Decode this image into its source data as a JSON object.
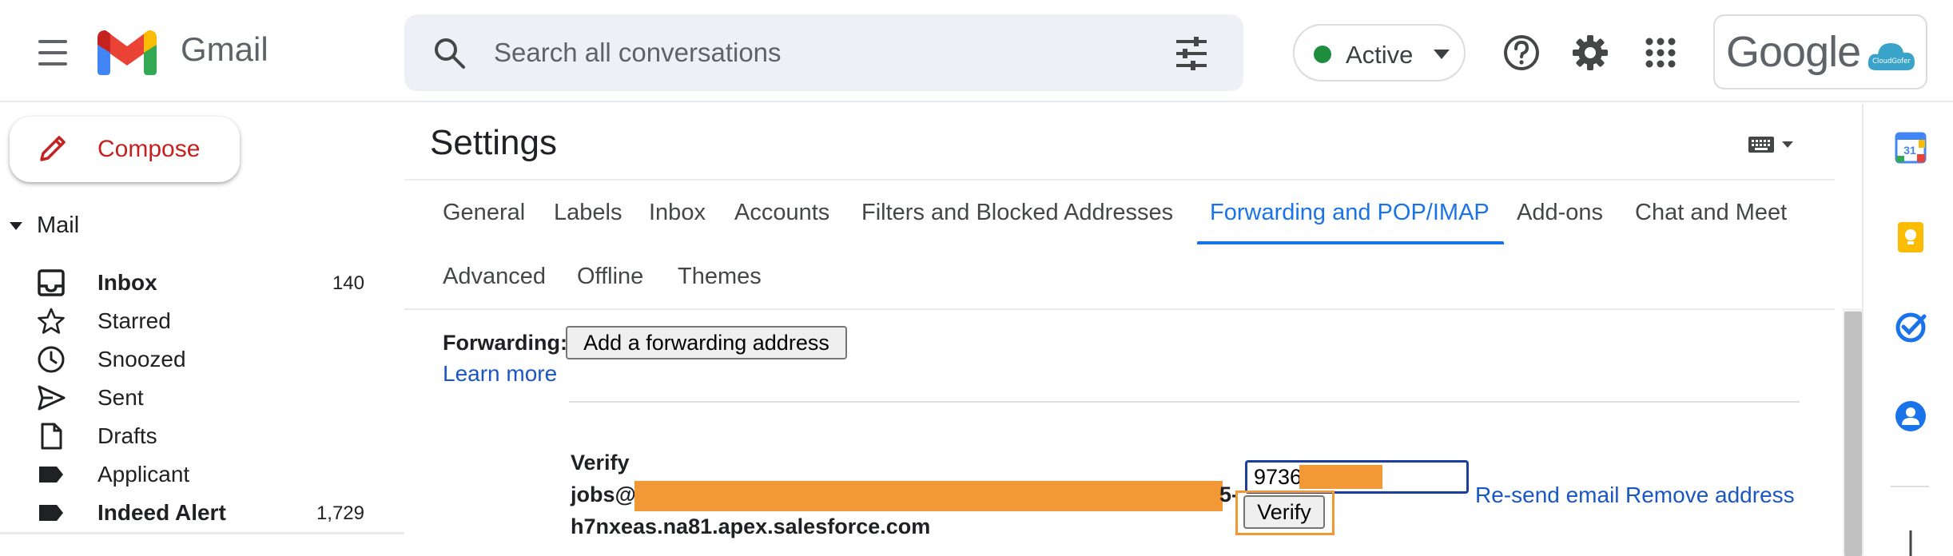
{
  "app": {
    "brand": "Gmail"
  },
  "search": {
    "placeholder": "Search all conversations"
  },
  "status": {
    "label": "Active",
    "color": "#1e8e3e"
  },
  "account": {
    "logo_text": "Google",
    "badge_text": "CloudGofer"
  },
  "compose": {
    "label": "Compose"
  },
  "nav": {
    "section": "Mail",
    "items": [
      {
        "label": "Inbox",
        "count": "140",
        "icon": "inbox-icon",
        "bold": true
      },
      {
        "label": "Starred",
        "count": "",
        "icon": "star-icon"
      },
      {
        "label": "Snoozed",
        "count": "",
        "icon": "clock-icon"
      },
      {
        "label": "Sent",
        "count": "",
        "icon": "send-icon"
      },
      {
        "label": "Drafts",
        "count": "",
        "icon": "draft-icon"
      },
      {
        "label": "Applicant",
        "count": "",
        "icon": "label-icon"
      },
      {
        "label": "Indeed Alert",
        "count": "1,729",
        "icon": "label-icon",
        "bold": true
      }
    ]
  },
  "settings": {
    "title": "Settings",
    "tabs": [
      "General",
      "Labels",
      "Inbox",
      "Accounts",
      "Filters and Blocked Addresses",
      "Forwarding and POP/IMAP",
      "Add-ons",
      "Chat and Meet",
      "Advanced",
      "Offline",
      "Themes"
    ],
    "active_tab": "Forwarding and POP/IMAP"
  },
  "forwarding": {
    "label": "Forwarding:",
    "add_button": "Add a forwarding address",
    "learn_more": "Learn more",
    "verify_title": "Verify",
    "email_prefix": "jobs@",
    "email_tail": "5-",
    "email_line2": "h7nxeas.na81.apex.salesforce.com",
    "code_value": "9736",
    "verify_button": "Verify",
    "resend_link": "Re-send email",
    "remove_link": "Remove address"
  },
  "colors": {
    "accent": "#1a73e8",
    "link": "#1a56c4",
    "redaction": "#f29837",
    "compose_text": "#c5221f"
  }
}
